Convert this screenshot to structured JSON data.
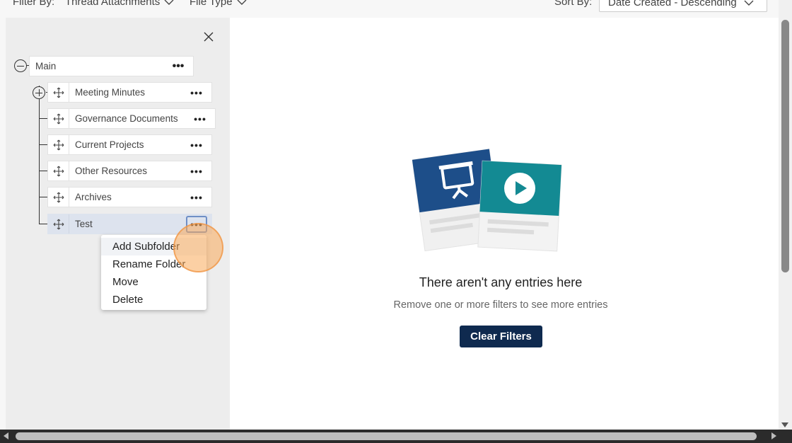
{
  "filter_bar": {
    "filter_by_label": "Filter By:",
    "thread_attachments": "Thread Attachments",
    "file_type": "File Type",
    "sort_by_label": "Sort By:",
    "sort_value": "Date Created - Descending"
  },
  "tree": {
    "root": {
      "label": "Main",
      "more": "•••"
    },
    "folders": [
      {
        "label": "Meeting Minutes",
        "more": "•••"
      },
      {
        "label": "Governance Documents",
        "more": "•••"
      },
      {
        "label": "Current Projects",
        "more": "•••"
      },
      {
        "label": "Other Resources",
        "more": "•••"
      },
      {
        "label": "Archives",
        "more": "•••"
      },
      {
        "label": "Test",
        "more": "•••"
      }
    ]
  },
  "context_menu": {
    "items": [
      {
        "label": "Add Subfolder"
      },
      {
        "label": "Rename Folder"
      },
      {
        "label": "Move"
      },
      {
        "label": "Delete"
      }
    ]
  },
  "empty_state": {
    "title": "There aren't any entries here",
    "subtitle": "Remove one or more filters to see more entries",
    "clear_button": "Clear Filters"
  },
  "icons": {
    "close": "close-icon",
    "move": "move-icon",
    "more": "more-icon",
    "collapse": "collapse-icon",
    "expand": "expand-icon",
    "presentation": "presentation-icon",
    "video": "video-play-icon"
  },
  "colors": {
    "primary_button": "#0f2a4f",
    "illustration_blue": "#1d4e89",
    "illustration_teal": "#138a93",
    "selected_row": "#dde3ee",
    "click_highlight": "#f6a860"
  }
}
